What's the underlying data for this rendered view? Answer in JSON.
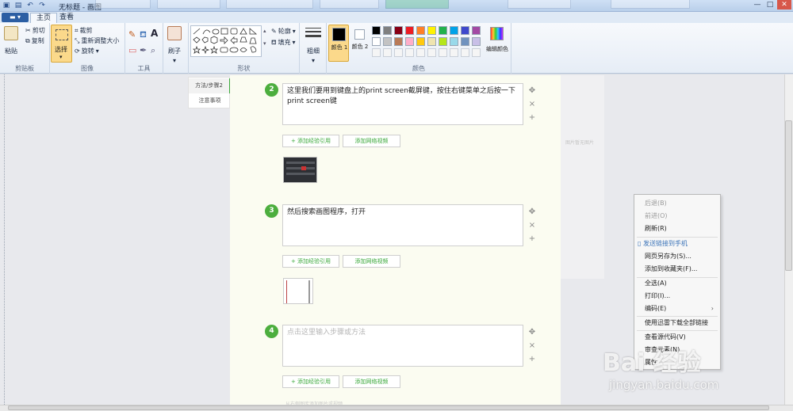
{
  "window": {
    "title": "无标题 - 画图",
    "controls": [
      "—",
      "□",
      "✕"
    ]
  },
  "tabs": {
    "menu": "▬ ▾",
    "home": "主页",
    "view": "查看"
  },
  "ribbon": {
    "clipboard": {
      "paste": "粘贴",
      "cut": "剪切",
      "copy": "复制",
      "label": "剪贴板"
    },
    "image": {
      "select": "选择",
      "crop": "裁剪",
      "resize": "重新调整大小",
      "rotate": "旋转",
      "label": "图像"
    },
    "tools": {
      "label": "工具",
      "text_glyph": "A"
    },
    "brush": {
      "label": "刷子"
    },
    "shapes": {
      "outline": "轮廓",
      "fill": "填充",
      "label": "形状"
    },
    "size": {
      "label": "粗细"
    },
    "colors": {
      "color1": "颜色 1",
      "color2": "颜色 2",
      "edit": "编辑颜色",
      "label": "颜色",
      "palette_row1": [
        "#000000",
        "#7f7f7f",
        "#880015",
        "#ed1c24",
        "#ff7f27",
        "#fff200",
        "#22b14c",
        "#00a2e8",
        "#3f48cc",
        "#a349a4"
      ],
      "palette_row2": [
        "#ffffff",
        "#c3c3c3",
        "#b97a57",
        "#ffaec9",
        "#ffc90e",
        "#efe4b0",
        "#b5e61d",
        "#99d9ea",
        "#7092be",
        "#c8bfe7"
      ]
    }
  },
  "sidebar": {
    "items": [
      "方法/步骤2",
      "注意事项"
    ]
  },
  "steps": [
    {
      "num": "2",
      "text": "这里我们要用到键盘上的print screen截屏键，按住右键菜单之后按一下print screen键"
    },
    {
      "num": "3",
      "text": "然后搜索画图程序，打开"
    },
    {
      "num": "4",
      "placeholder": "点击这里输入步骤或方法"
    }
  ],
  "step_controls": {
    "move": "✥",
    "remove": "×",
    "add": "+"
  },
  "buttons": {
    "add_quote": "+ 添加经验引用",
    "add_video": "添加网络视频"
  },
  "right_placeholder": "图片暂无图片",
  "footer_hint": "从右侧图库添加图片或视频",
  "context_menu": {
    "items": [
      {
        "label": "后退(B)",
        "state": "disabled"
      },
      {
        "label": "前进(O)",
        "state": "disabled"
      },
      {
        "label": "刷新(R)",
        "state": "normal"
      },
      {
        "label": "发送链接到手机",
        "state": "accent"
      },
      {
        "label": "网页另存为(S)...",
        "state": "normal"
      },
      {
        "label": "添加到收藏夹(F)...",
        "state": "normal"
      },
      {
        "label": "全选(A)",
        "state": "normal"
      },
      {
        "label": "打印(I)...",
        "state": "normal"
      },
      {
        "label": "编码(E)",
        "state": "normal",
        "submenu": "›"
      },
      {
        "label": "使用迅雷下载全部链接",
        "state": "normal"
      },
      {
        "label": "查看源代码(V)",
        "state": "normal"
      },
      {
        "label": "审查元素(N)",
        "state": "normal"
      },
      {
        "label": "属性",
        "state": "normal"
      }
    ]
  },
  "watermark": {
    "brand": "Bai 经验",
    "url": "jingyan.baidu.com"
  }
}
